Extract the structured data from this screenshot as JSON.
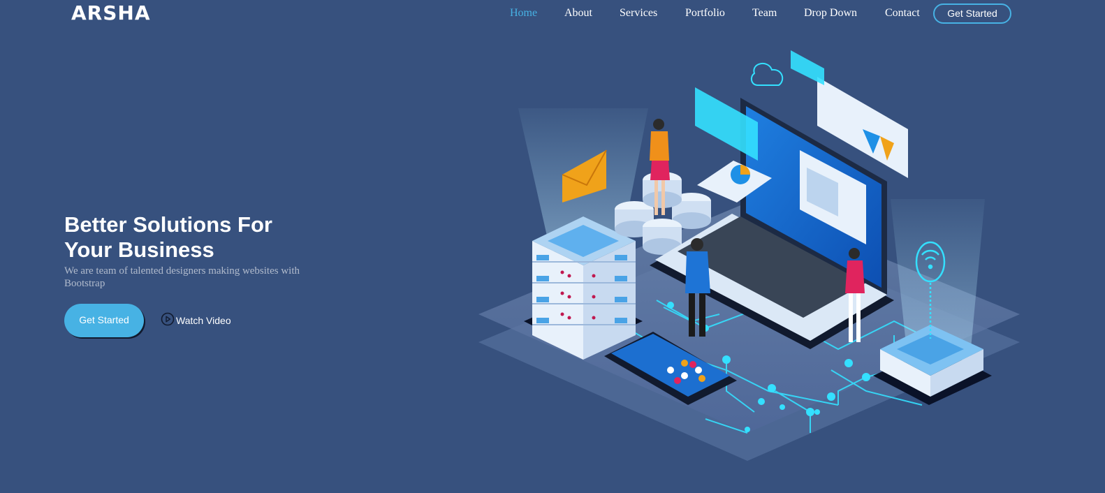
{
  "header": {
    "logo": "ARSHA",
    "nav": [
      {
        "label": "Home",
        "active": true
      },
      {
        "label": "About"
      },
      {
        "label": "Services"
      },
      {
        "label": "Portfolio"
      },
      {
        "label": "Team"
      },
      {
        "label": "Drop Down"
      },
      {
        "label": "Contact"
      }
    ],
    "cta_label": "Get Started"
  },
  "hero": {
    "title_line1": "Better Solutions For",
    "title_line2": "Your Business",
    "subtitle": "We are team of talented designers making websites with Bootstrap",
    "primary_button": "Get Started",
    "video_button": "Watch Video",
    "video_icon": "play-circle-icon",
    "illustration": "isometric-tech-illustration"
  },
  "colors": {
    "background": "#37517e",
    "accent": "#47b2e4",
    "text": "#ffffff"
  }
}
